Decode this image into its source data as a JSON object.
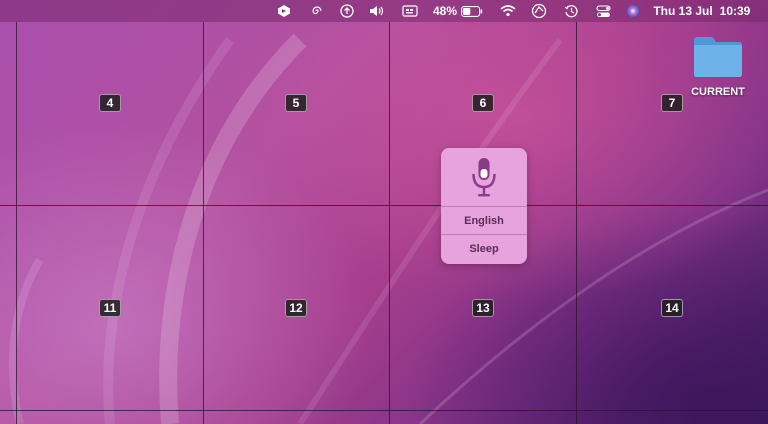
{
  "menubar": {
    "battery_percent": "48%",
    "battery_level": 0.48,
    "date": "Thu 13 Jul",
    "time": "10:39",
    "icons": [
      "app-icon",
      "spiral-icon",
      "upload-icon",
      "volume-icon",
      "input-source-icon",
      "battery-icon",
      "wifi-icon",
      "location-icon",
      "time-machine-icon",
      "control-center-icon",
      "siri-icon"
    ]
  },
  "grid": {
    "labels": [
      "4",
      "5",
      "6",
      "7",
      "11",
      "12",
      "13",
      "14"
    ]
  },
  "desktop": {
    "folder_label": "CURRENT",
    "folder_color": "#6db3ea"
  },
  "dictation": {
    "language": "English",
    "sleep": "Sleep",
    "mic_color": "#8a3a86"
  }
}
